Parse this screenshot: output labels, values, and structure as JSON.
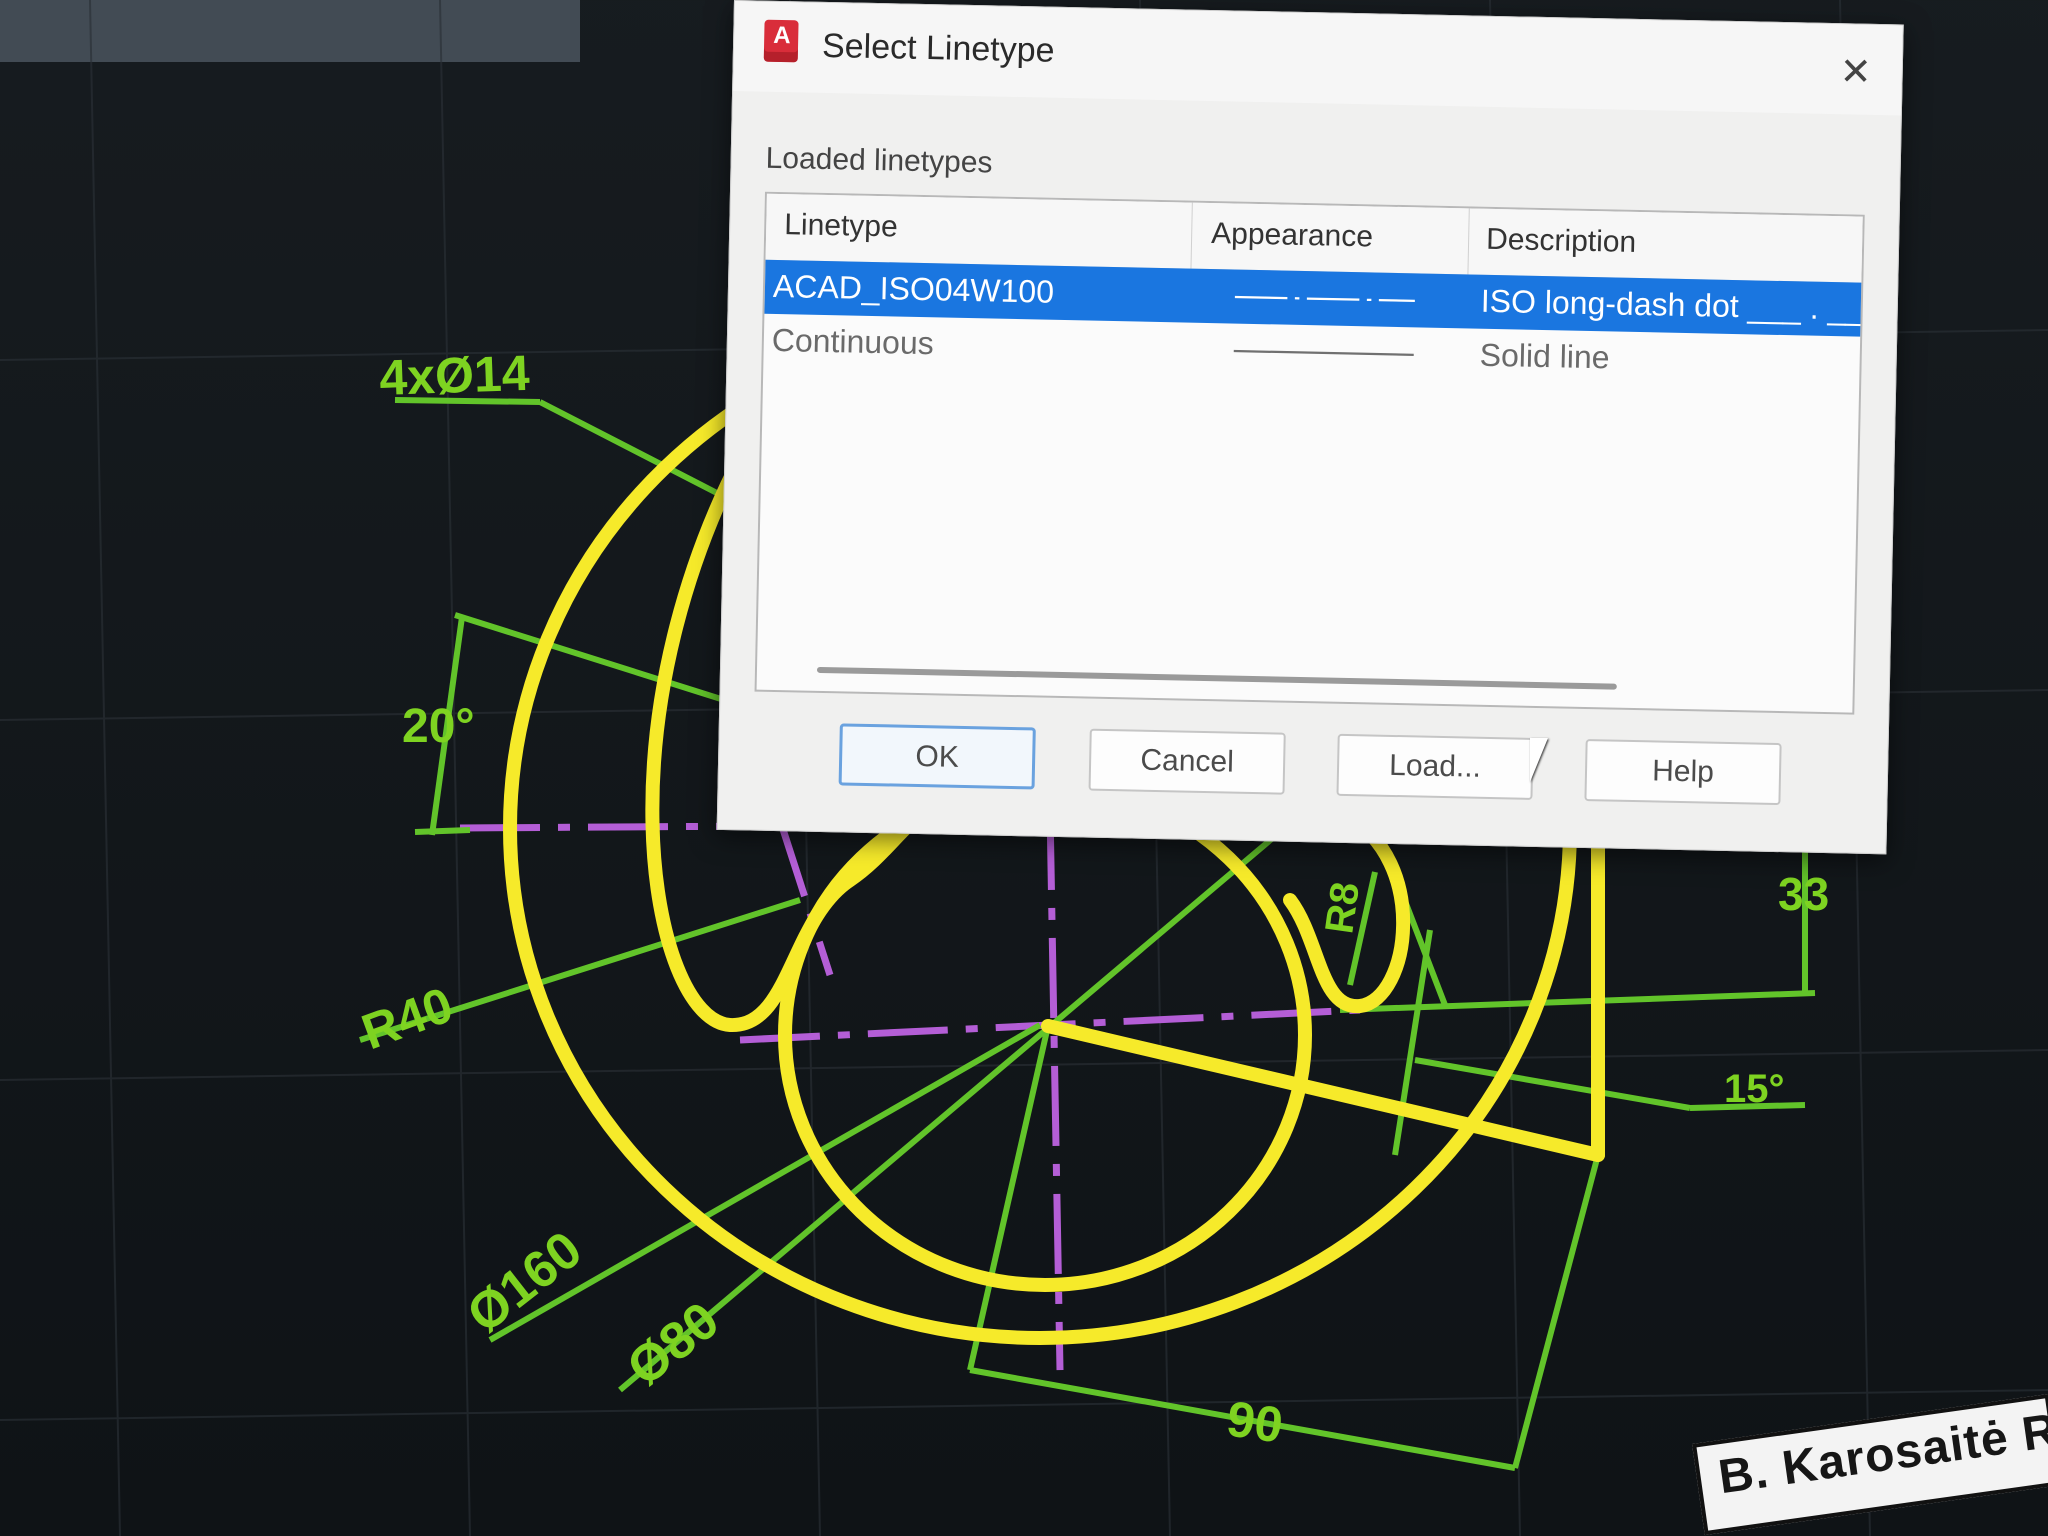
{
  "drawing": {
    "dimensions": {
      "holes": "4xØ14",
      "angle_20": "20°",
      "radius_40": "R40",
      "dia_160": "Ø160",
      "dia_80": "Ø80",
      "radius_8": "R8",
      "dim_33": "33",
      "angle_15": "15°",
      "dim_90": "90"
    },
    "title_block": "B. Karosaitė R",
    "colors": {
      "geometry": "#f6ea2a",
      "dimension": "#6ccf2b",
      "centerline": "#b45ed6",
      "background": "#12171b"
    }
  },
  "dialog": {
    "title": "Select Linetype",
    "app_icon": "autocad-app-icon",
    "close_icon": "close-icon",
    "section_label": "Loaded linetypes",
    "columns": [
      "Linetype",
      "Appearance",
      "Description"
    ],
    "rows": [
      {
        "linetype": "ACAD_ISO04W100",
        "appearance": "long-dash-dot-pattern",
        "description": "ISO long-dash dot ___ . ___",
        "selected": true
      },
      {
        "linetype": "Continuous",
        "appearance": "solid-pattern",
        "description": "Solid line",
        "selected": false
      }
    ],
    "buttons": {
      "ok": "OK",
      "cancel": "Cancel",
      "load": "Load...",
      "help": "Help"
    },
    "selection_color": "#1a76e0"
  }
}
